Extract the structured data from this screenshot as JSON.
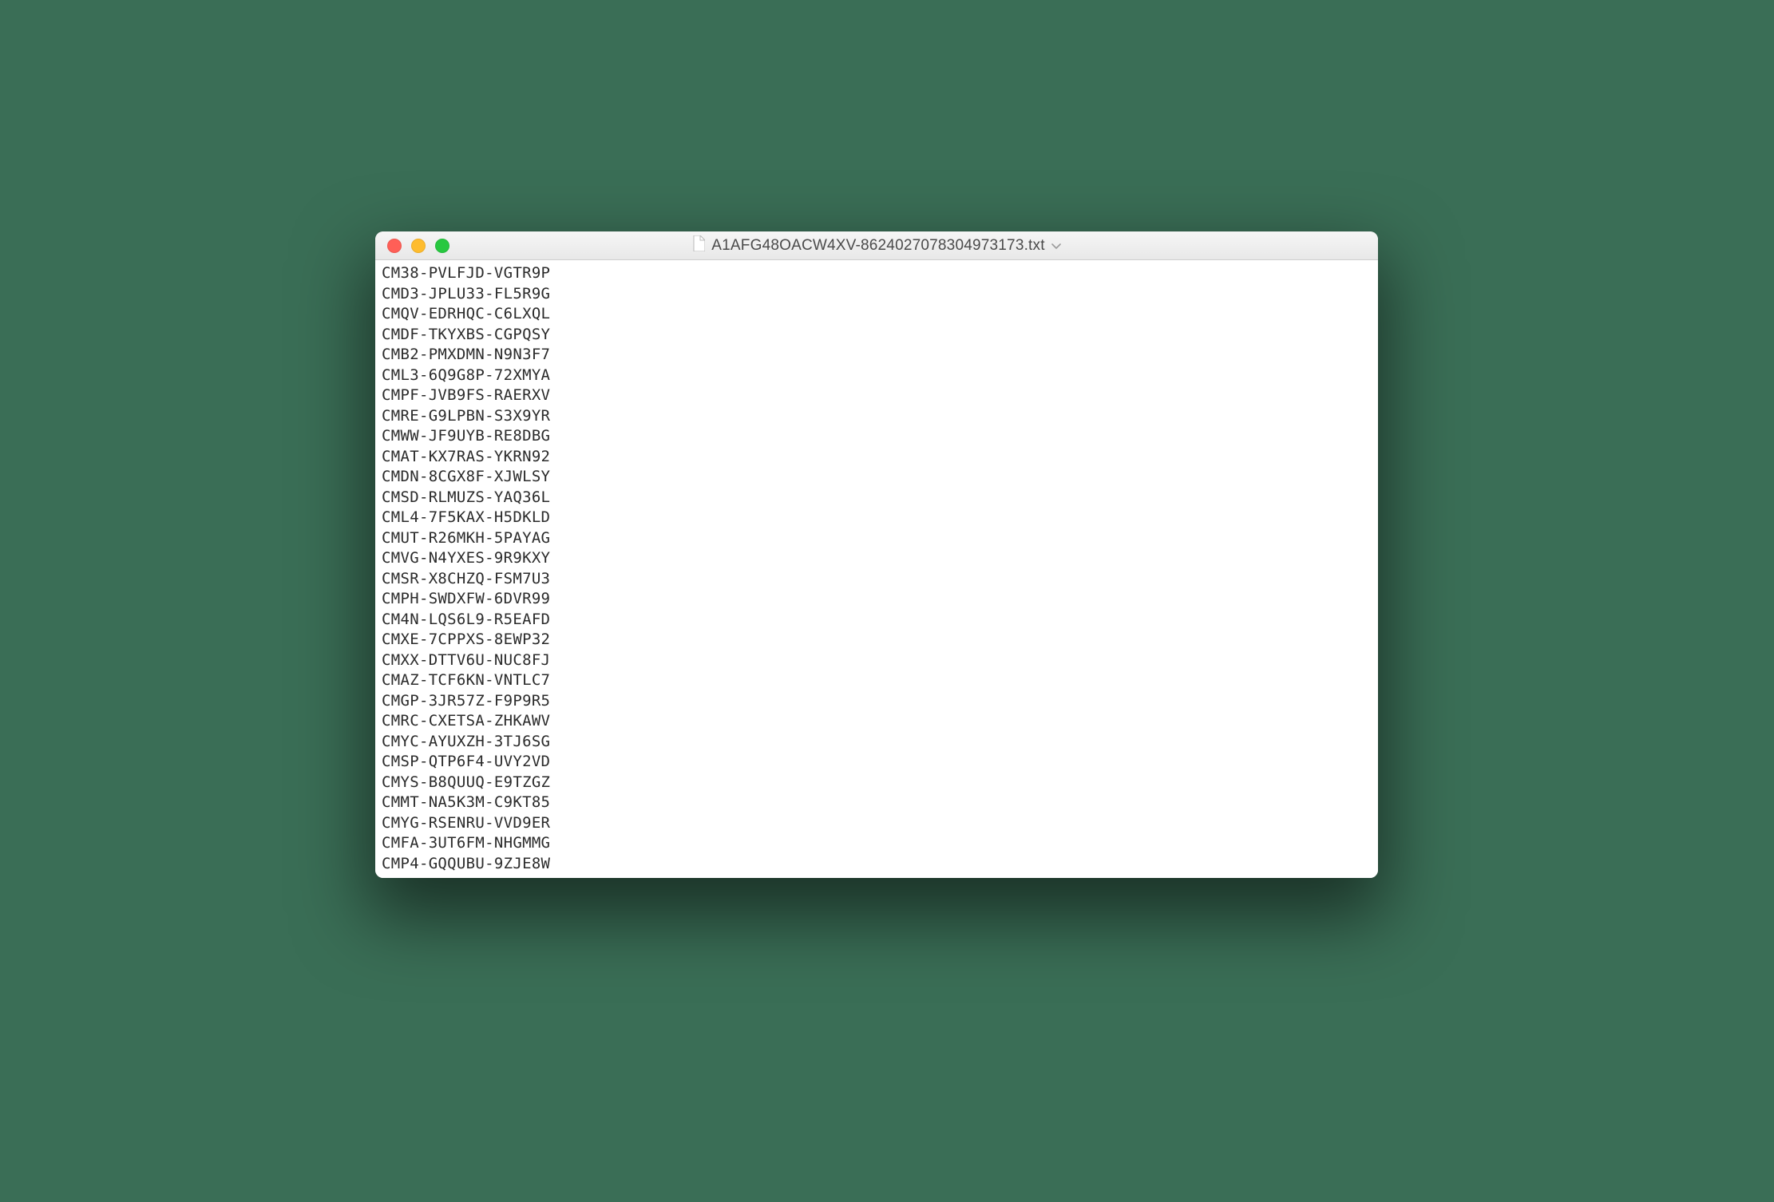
{
  "window": {
    "title": "A1AFG48OACW4XV-8624027078304973173.txt"
  },
  "lines": [
    "CM38-PVLFJD-VGTR9P",
    "CMD3-JPLU33-FL5R9G",
    "CMQV-EDRHQC-C6LXQL",
    "CMDF-TKYXBS-CGPQSY",
    "CMB2-PMXDMN-N9N3F7",
    "CML3-6Q9G8P-72XMYA",
    "CMPF-JVB9FS-RAERXV",
    "CMRE-G9LPBN-S3X9YR",
    "CMWW-JF9UYB-RE8DBG",
    "CMAT-KX7RAS-YKRN92",
    "CMDN-8CGX8F-XJWLSY",
    "CMSD-RLMUZS-YAQ36L",
    "CML4-7F5KAX-H5DKLD",
    "CMUT-R26MKH-5PAYAG",
    "CMVG-N4YXES-9R9KXY",
    "CMSR-X8CHZQ-FSM7U3",
    "CMPH-SWDXFW-6DVR99",
    "CM4N-LQS6L9-R5EAFD",
    "CMXE-7CPPXS-8EWP32",
    "CMXX-DTTV6U-NUC8FJ",
    "CMAZ-TCF6KN-VNTLC7",
    "CMGP-3JR57Z-F9P9R5",
    "CMRC-CXETSA-ZHKAWV",
    "CMYC-AYUXZH-3TJ6SG",
    "CMSP-QTP6F4-UVY2VD",
    "CMYS-B8QUUQ-E9TZGZ",
    "CMMT-NA5K3M-C9KT85",
    "CMYG-RSENRU-VVD9ER",
    "CMFA-3UT6FM-NHGMMG",
    "CMP4-GQQUBU-9ZJE8W"
  ]
}
